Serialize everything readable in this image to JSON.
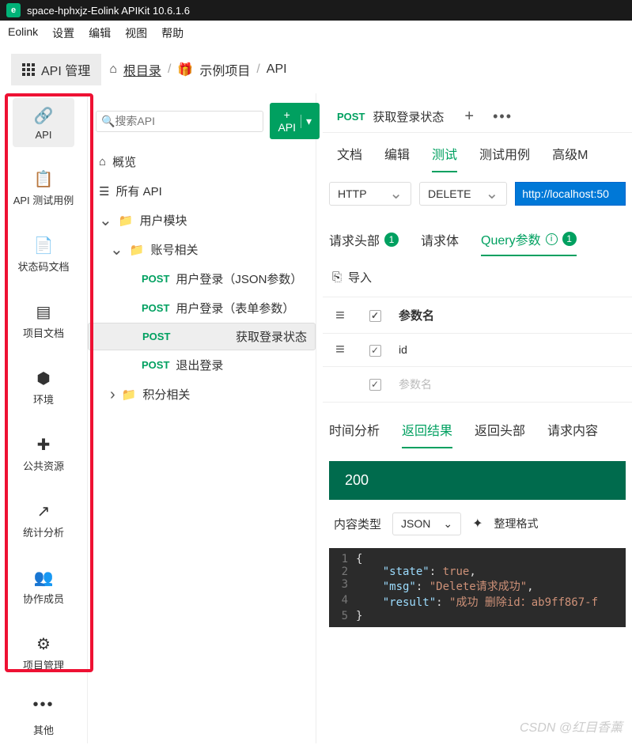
{
  "window": {
    "title": "space-hphxjz-Eolink APIKit 10.6.1.6"
  },
  "menu": {
    "items": [
      "Eolink",
      "设置",
      "编辑",
      "视图",
      "帮助"
    ]
  },
  "toolbar": {
    "api_mgmt": "API 管理",
    "breadcrumb": {
      "root": "根目录",
      "project": "示例项目",
      "last": "API"
    }
  },
  "sidenav": {
    "items": [
      {
        "label": "API"
      },
      {
        "label": "API 测试用例"
      },
      {
        "label": "状态码文档"
      },
      {
        "label": "项目文档"
      },
      {
        "label": "环境"
      },
      {
        "label": "公共资源"
      },
      {
        "label": "统计分析"
      },
      {
        "label": "协作成员"
      },
      {
        "label": "项目管理"
      }
    ],
    "other": "其他"
  },
  "tree": {
    "search_placeholder": "搜索API",
    "add_api": "+ API",
    "overview": "概览",
    "all_api": "所有 API",
    "group1": "用户模块",
    "group2": "账号相关",
    "apis": [
      {
        "method": "POST",
        "name": "用户登录（JSON参数）"
      },
      {
        "method": "POST",
        "name": "用户登录（表单参数）"
      },
      {
        "method": "POST",
        "name": "获取登录状态"
      },
      {
        "method": "POST",
        "name": "退出登录"
      }
    ],
    "group3": "积分相关"
  },
  "content": {
    "tab_method": "POST",
    "tab_title": "获取登录状态",
    "subtabs": [
      "文档",
      "编辑",
      "测试",
      "测试用例",
      "高级M"
    ],
    "subtab_active": 2,
    "protocol": "HTTP",
    "http_method": "DELETE",
    "url": "http://localhost:50",
    "param_tabs": {
      "headers": "请求头部",
      "body": "请求体",
      "query": "Query参数"
    },
    "import": "导入",
    "table": {
      "header": "参数名",
      "row1": "id",
      "row2_ph": "参数名"
    },
    "result_tabs": [
      "时间分析",
      "返回结果",
      "返回头部",
      "请求内容"
    ],
    "result_active": 1,
    "status": "200",
    "content_type_label": "内容类型",
    "content_type_value": "JSON",
    "format": "整理格式",
    "code": {
      "l1": "{",
      "l2a": "\"state\"",
      "l2b": ": ",
      "l2c": "true",
      "l2d": ",",
      "l3a": "\"msg\"",
      "l3b": ": ",
      "l3c": "\"Delete请求成功\"",
      "l3d": ",",
      "l4a": "\"result\"",
      "l4b": ": ",
      "l4c": "\"成功 删除id：ab9ff867-f",
      "l5": "}"
    }
  },
  "watermark": "CSDN @红目香薰"
}
